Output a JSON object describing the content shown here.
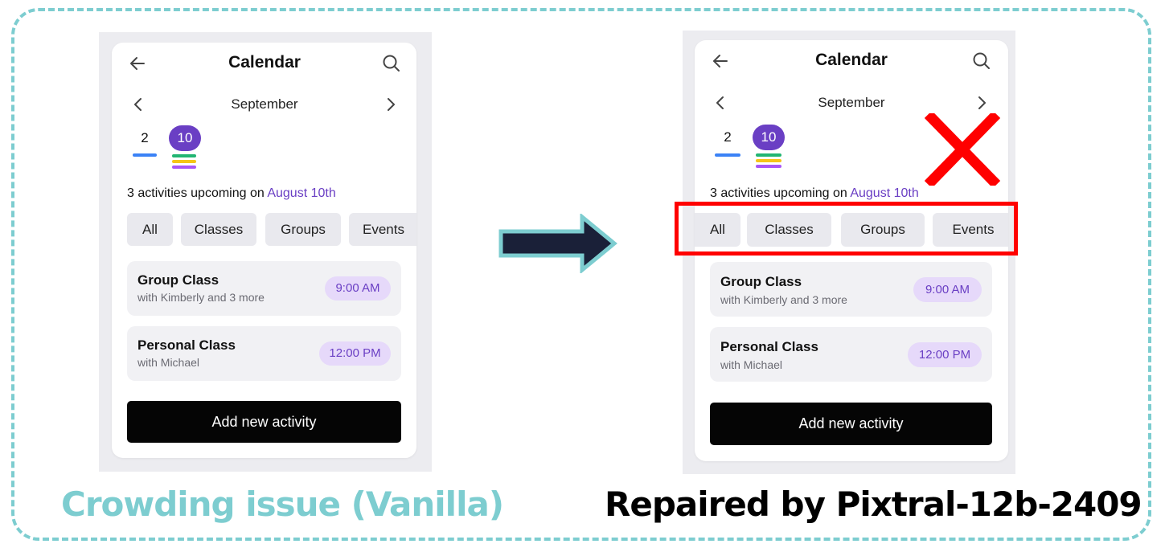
{
  "colors": {
    "frame_border": "#7dcdd0",
    "accent_purple": "#6a3fc4",
    "pill_bg": "#e6d9fa",
    "annotation_red": "#ff0000",
    "arrow_fill": "#1a2038"
  },
  "captions": {
    "left": "Crowding issue (Vanilla)",
    "right": "Repaired by Pixtral-12b-2409"
  },
  "annotations": {
    "arrow_icon": "right-arrow-icon",
    "x_icon": "red-x-icon",
    "highlight": "red-highlight-box"
  },
  "left_screen": {
    "header": {
      "back_icon": "arrow-left-icon",
      "title": "Calendar",
      "search_icon": "search-icon"
    },
    "month_nav": {
      "prev_icon": "chevron-left-icon",
      "month": "September",
      "next_icon": "chevron-right-icon"
    },
    "days": [
      {
        "num": "2",
        "selected": false,
        "markers": [
          "#3b82f6"
        ]
      },
      {
        "num": "10",
        "selected": true,
        "markers": [
          "#22b573",
          "#f5c518",
          "#a855f7"
        ]
      }
    ],
    "upcoming": {
      "prefix": "3 activities upcoming on ",
      "date": "August 10th"
    },
    "filters": [
      "All",
      "Classes",
      "Groups",
      "Events"
    ],
    "activities": [
      {
        "title": "Group Class",
        "subtitle": "with Kimberly and 3 more",
        "time": "9:00 AM"
      },
      {
        "title": "Personal Class",
        "subtitle": "with Michael",
        "time": "12:00 PM"
      }
    ],
    "add_button": "Add new activity"
  },
  "right_screen": {
    "header": {
      "back_icon": "arrow-left-icon",
      "title": "Calendar",
      "search_icon": "search-icon"
    },
    "month_nav": {
      "prev_icon": "chevron-left-icon",
      "month": "September",
      "next_icon": "chevron-right-icon"
    },
    "days": [
      {
        "num": "2",
        "selected": false,
        "markers": [
          "#3b82f6"
        ]
      },
      {
        "num": "10",
        "selected": true,
        "markers": [
          "#22b573",
          "#f5c518",
          "#a855f7"
        ]
      }
    ],
    "upcoming": {
      "prefix": "3 activities upcoming on ",
      "date": "August 10th"
    },
    "filters": [
      "All",
      "Classes",
      "Groups",
      "Events"
    ],
    "activities": [
      {
        "title": "Group Class",
        "subtitle": "with Kimberly and 3 more",
        "time": "9:00 AM"
      },
      {
        "title": "Personal Class",
        "subtitle": "with Michael",
        "time": "12:00 PM"
      }
    ],
    "add_button": "Add new activity"
  }
}
